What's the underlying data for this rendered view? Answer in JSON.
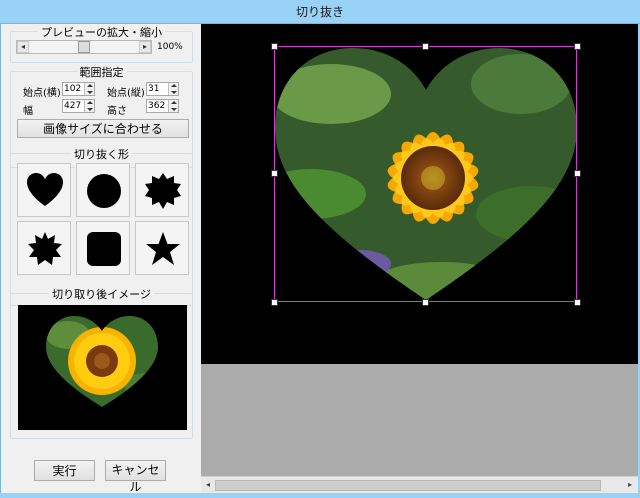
{
  "window": {
    "title": "切り抜き"
  },
  "preview_zoom": {
    "title": "プレビューの拡大・縮小",
    "value_label": "100%",
    "slider_fraction": 0.5
  },
  "range": {
    "title": "範囲指定",
    "start_x_label": "始点(横)",
    "start_x_value": "102",
    "start_y_label": "始点(縦)",
    "start_y_value": "31",
    "width_label": "幅",
    "width_value": "427",
    "height_label": "高さ",
    "height_value": "362",
    "fit_button": "画像サイズに合わせる"
  },
  "shapes": {
    "title": "切り抜く形",
    "items": [
      {
        "icon": "heart-icon"
      },
      {
        "icon": "circle-icon"
      },
      {
        "icon": "starburst-icon"
      },
      {
        "icon": "flower-icon"
      },
      {
        "icon": "rounded-square-icon"
      },
      {
        "icon": "star-icon"
      }
    ]
  },
  "result_preview": {
    "title": "切り取り後イメージ"
  },
  "actions": {
    "run": "実行",
    "cancel": "キャンセル"
  },
  "colors": {
    "titlebar": "#98d2f6",
    "selection": "#d43cd4",
    "canvas": "#000000",
    "empty_area": "#ababab"
  }
}
